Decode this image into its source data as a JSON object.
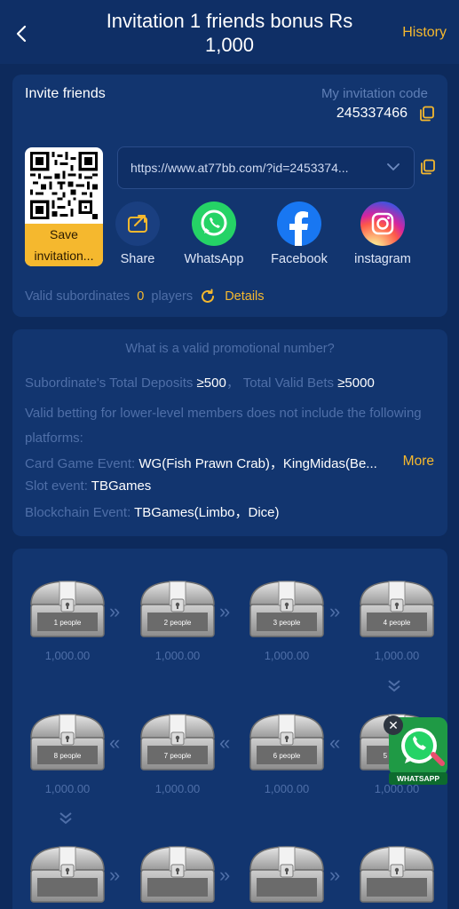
{
  "header": {
    "title": "Invitation 1 friends bonus Rs 1,000",
    "history_label": "History"
  },
  "invite": {
    "label": "Invite friends",
    "code_label": "My invitation code",
    "code": "245337466",
    "url": "https://www.at77bb.com/?id=2453374...",
    "save_label": "Save invitation...",
    "save_line1": "Save",
    "save_line2": "invitation...",
    "share": [
      {
        "label": "Share",
        "icon": "share-icon",
        "color": "#1a3f80"
      },
      {
        "label": "WhatsApp",
        "icon": "whatsapp-icon",
        "color": "#25d366"
      },
      {
        "label": "Facebook",
        "icon": "facebook-icon",
        "color": "#1877f2"
      },
      {
        "label": "instagram",
        "icon": "instagram-icon",
        "color": "#d6249f"
      }
    ],
    "valid_prefix": "Valid subordinates",
    "valid_count": "0",
    "valid_suffix": "players",
    "details_label": "Details"
  },
  "rules": {
    "title": "What is a valid promotional number?",
    "deposits_label": "Subordinate's Total Deposits",
    "deposits_value": "≥500",
    "bets_label": "Total Valid Bets",
    "bets_value": "≥5000",
    "note_line1": "Valid betting for lower-level members does not include the following",
    "note_line2": "platforms:",
    "card_label": "Card Game Event:",
    "card_value": "WG(Fish Prawn Crab)，KingMidas(Be...",
    "more_label": "More",
    "slot_label": "Slot event:",
    "slot_value": "TBGames",
    "blockchain_label": "Blockchain Event:",
    "blockchain_value": "TBGames(Limbo，Dice)"
  },
  "chests": [
    {
      "label": "1 people",
      "amount": "1,000.00"
    },
    {
      "label": "2 people",
      "amount": "1,000.00"
    },
    {
      "label": "3 people",
      "amount": "1,000.00"
    },
    {
      "label": "4 people",
      "amount": "1,000.00"
    },
    {
      "label": "8 people",
      "amount": "1,000.00"
    },
    {
      "label": "7 people",
      "amount": "1,000.00"
    },
    {
      "label": "6 people",
      "amount": "1,000.00"
    },
    {
      "label": "5 people",
      "amount": "1,000.00"
    }
  ],
  "whatsapp_float": {
    "close": "✕",
    "badge": "WHATSAPP"
  },
  "colors": {
    "accent": "#f5b82e",
    "background": "#0d2a5c",
    "card": "#12356f",
    "muted_text": "#4f6fa8"
  }
}
